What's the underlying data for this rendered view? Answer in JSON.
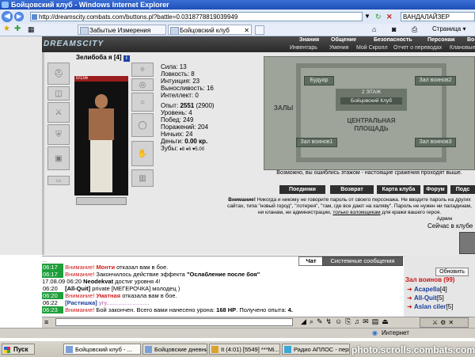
{
  "window": {
    "title": "Бойцовский клуб - Windows Internet Explorer"
  },
  "address": {
    "url": "http://dreamscity.combats.com/buttons.pl?battle=0.0318778819039949",
    "search_value": "ВАНДАЛАЙЗЕР",
    "page_label": "Страница"
  },
  "tabs": [
    {
      "label": "Забытые Измерения"
    },
    {
      "label": "Бойцовский клуб"
    }
  ],
  "game": {
    "logo": "DREAMSCITY",
    "menu_top": [
      "Знания",
      "Общение",
      "Безопасность",
      "Персонаж",
      "Во"
    ],
    "menu_bottom": [
      "Инвентарь",
      "Умения",
      "Мой Скролл",
      "Отчет о переводах",
      "Клановые"
    ],
    "character": {
      "name": "Зелибоба я",
      "level": "[4]",
      "hp": "0/156",
      "stats": [
        "Сила: 13",
        "Ловкость: 8",
        "Интуиция: 23",
        "Выносливость: 16",
        "Интеллект: 0"
      ],
      "experience_label": "Опыт:",
      "experience_value": "2551",
      "experience_next": "(2900)",
      "progress": [
        "Уровень: 4",
        "Побед: 249",
        "Поражений: 204",
        "Ничьих: 24"
      ],
      "money_label": "Деньги:",
      "money_value": "0.00 кр.",
      "teeth_label": "Зубы:",
      "teeth_value": "♦8 ♦6 ♥5.00"
    },
    "map": {
      "floor": "2 ЭТАЖ",
      "club": "Бойцовский Клуб",
      "center_label": "ЦЕНТРАЛЬНАЯ\nПЛОЩАДЬ",
      "halls": "ЗАЛЫ",
      "buttons": [
        "Будуар",
        "Зал воинов2",
        "Зал воинов1",
        "Зал воинов3"
      ],
      "message": "Возможно, вы ошиблись этажом - настоящие сражения проходят выше."
    },
    "action_buttons": [
      "Поединки",
      "Возврат",
      "Карта клуба",
      "Форум",
      "Подс"
    ],
    "warning": {
      "bold": "Внимание!",
      "text1": " Никогда и никому не говорите пароль от своего персонажа. Не вводите пароль на других",
      "text2": "сайтах, типа \"новый город\", \"лотерея\", \"там, где все дают на халяву\". Пароль не нужен ни паладинам,",
      "text3": "ни кланам, ни администрации,",
      "link": "только взломщикам",
      "text4": "для кражи вашего героя.",
      "admin": "Админ",
      "online": "Сейчас в клубе 3"
    }
  },
  "chat": {
    "tab_chat": "Чат",
    "tab_system": "Системные сообщения",
    "refresh": "Обновить",
    "hall": "Зал воинов (99)",
    "users": [
      {
        "name": "Acapella",
        "level": "[4]"
      },
      {
        "name": "All-Quit",
        "level": "[5]"
      },
      {
        "name": "Aslan ciler",
        "level": "[5]"
      }
    ],
    "lines": [
      {
        "time": "06:17",
        "time_style": "green",
        "a": "Внимание!",
        "a_style": "red",
        "b": " ",
        "name": "Монти",
        "name_style": "red",
        "c": " отказал вам в бое.",
        "extra": ""
      },
      {
        "time": "06:17",
        "time_style": "green",
        "a": "Внимание!",
        "a_style": "red",
        "b": " Закончилось действие эффекта ",
        "name": "\"Ослабление после боя\"",
        "name_style": "bold",
        "c": "",
        "extra": ""
      },
      {
        "time": "17.08.09 06:20",
        "time_style": "plain",
        "a": "",
        "a_style": "",
        "b": "",
        "name": "Neodekvat",
        "name_style": "bold",
        "c": " достиг уровня 4!",
        "extra": ""
      },
      {
        "time": "06:20",
        "time_style": "plain",
        "a": "",
        "a_style": "",
        "b": "",
        "name": "[All-Quit]",
        "name_style": "bold",
        "c": " private [МЕГЕРОЧКА] молодец )",
        "extra": ""
      },
      {
        "time": "06:20",
        "time_style": "green",
        "a": "Внимание!",
        "a_style": "red",
        "b": " ",
        "name": "Уматная",
        "name_style": "red",
        "c": " отказала вам в бое.",
        "extra": ""
      },
      {
        "time": "06:22",
        "time_style": "plain",
        "a": "",
        "a_style": "",
        "b": "",
        "name": "[Растишка]",
        "name_style": "bold",
        "c": " ",
        "extra": "угу.........................."
      },
      {
        "time": "06:23",
        "time_style": "green",
        "a": "Внимание!",
        "a_style": "red",
        "b": " Бой закончен. Всего вами нанесено урона: ",
        "name": "168 HP",
        "name_style": "bold",
        "c": ". Получено опыта: ",
        "extra": "4."
      }
    ]
  },
  "status": {
    "zone": "Интернет"
  },
  "taskbar": {
    "start": "Пуск",
    "items": [
      "Бойцовский клуб - ...",
      "Бойцовские дневники...",
      "It (4:01) [5549] ***Mi...",
      "Радио АПЛОС - перва..."
    ]
  },
  "watermark": "photo.scrolls.combats.com"
}
